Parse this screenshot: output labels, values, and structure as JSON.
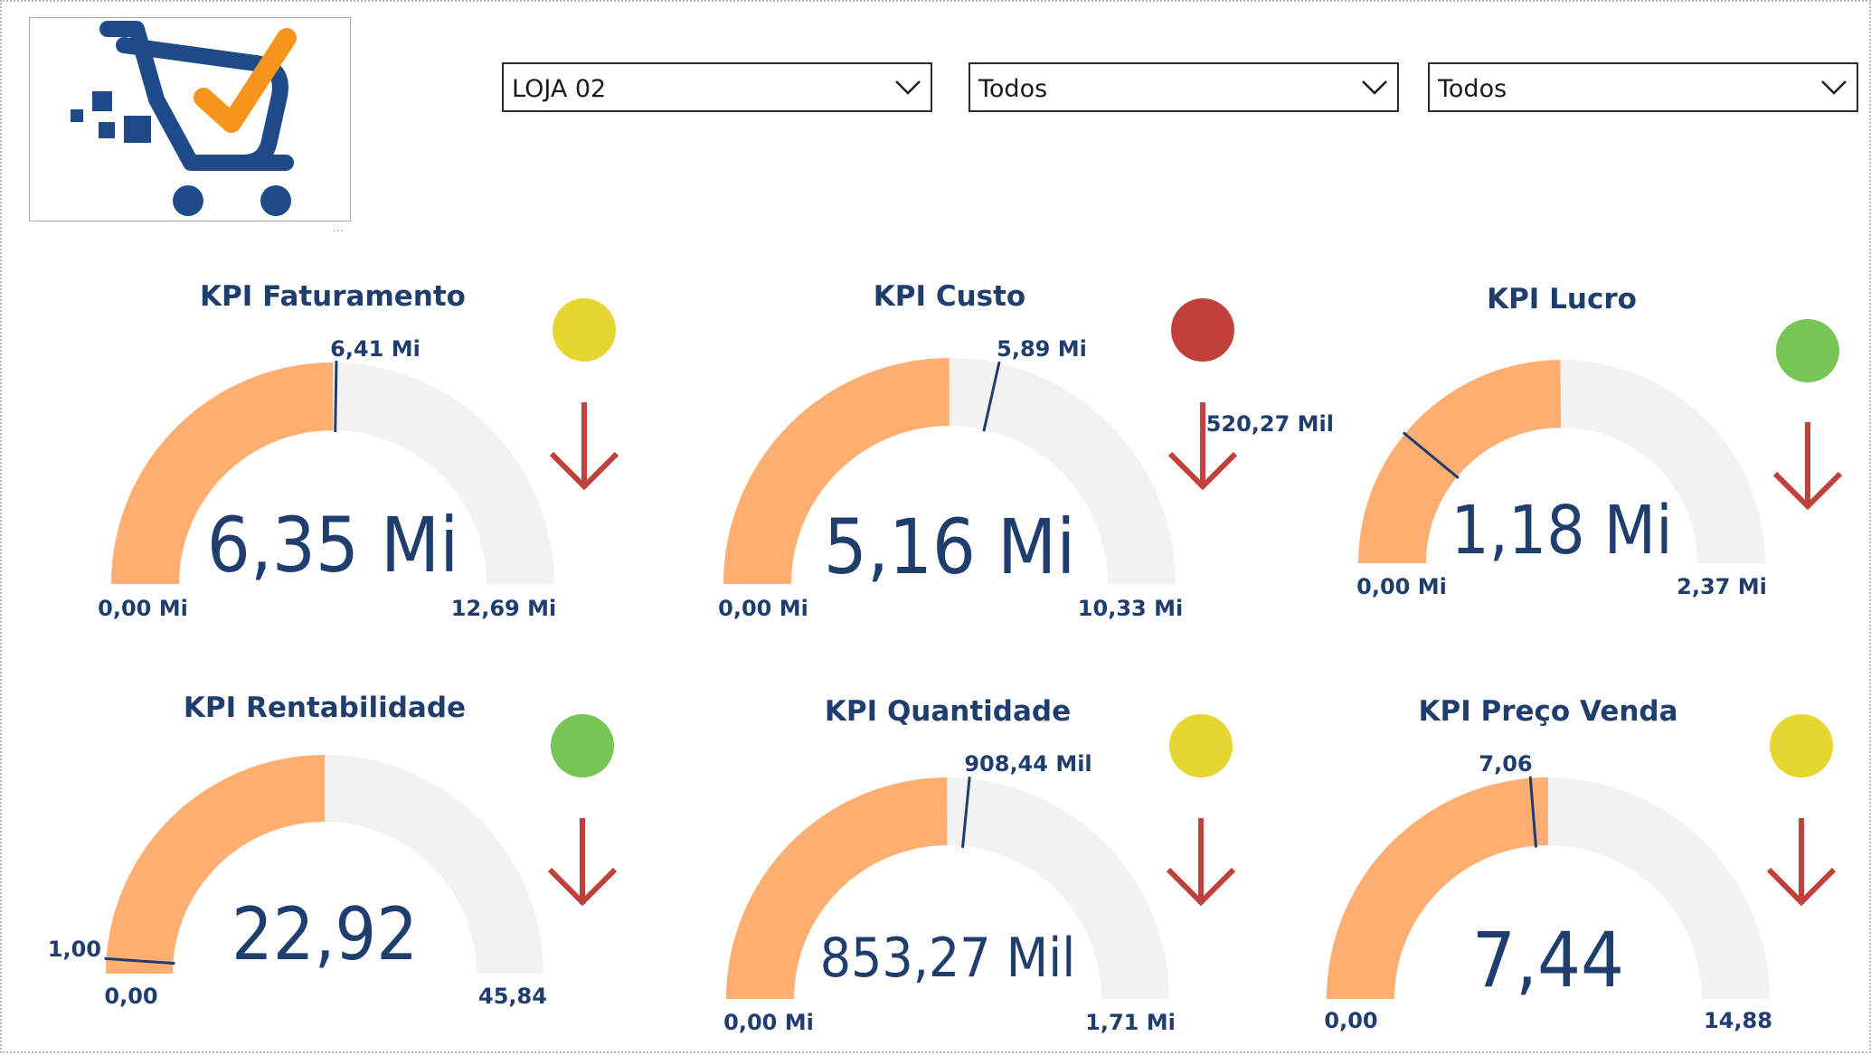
{
  "filters": [
    {
      "value": "LOJA 02",
      "icon": "chevron-down-icon"
    },
    {
      "value": "Todos",
      "icon": "chevron-down-icon"
    },
    {
      "value": "Todos",
      "icon": "chevron-down-icon"
    }
  ],
  "colors": {
    "fill": "#FDAE70",
    "track": "#F2F2F2",
    "text": "#1F3E6E",
    "needle": "#1F3E6E",
    "status_yellow": "#E6D631",
    "status_red": "#C0413B",
    "status_green": "#78C556",
    "arrow": "#C0413B"
  },
  "kpis": [
    {
      "title": "KPI Faturamento",
      "value": 6.35,
      "value_label": "6,35 Mi",
      "min": 0,
      "min_label": "0,00 Mi",
      "max": 12.69,
      "max_label": "12,69 Mi",
      "target": 6.41,
      "target_label": "6,41 Mi",
      "status": "yellow",
      "trend": "down",
      "status_icon": "status-dot-icon",
      "trend_icon": "arrow-down-icon"
    },
    {
      "title": "KPI Custo",
      "value": 5.16,
      "value_label": "5,16 Mi",
      "min": 0,
      "min_label": "0,00 Mi",
      "max": 10.33,
      "max_label": "10,33 Mi",
      "target": 5.89,
      "target_label": "5,89 Mi",
      "status": "red",
      "trend": "down",
      "status_icon": "status-dot-icon",
      "trend_icon": "arrow-down-icon"
    },
    {
      "title": "KPI Lucro",
      "value": 1.18,
      "value_label": "1,18 Mi",
      "min": 0,
      "min_label": "0,00 Mi",
      "max": 2.37,
      "max_label": "2,37 Mi",
      "target": 0.52027,
      "target_label": "520,27 Mil",
      "status": "green",
      "trend": "down",
      "status_icon": "status-dot-icon",
      "trend_icon": "arrow-down-icon"
    },
    {
      "title": "KPI Rentabilidade",
      "value": 22.92,
      "value_label": "22,92",
      "min": 0,
      "min_label": "0,00",
      "max": 45.84,
      "max_label": "45,84",
      "target": 1.0,
      "target_label": "1,00",
      "status": "green",
      "trend": "down",
      "status_icon": "status-dot-icon",
      "trend_icon": "arrow-down-icon"
    },
    {
      "title": "KPI Quantidade",
      "value": 853.27,
      "value_label": "853,27 Mil",
      "min": 0,
      "min_label": "0,00 Mi",
      "max": 1710,
      "max_label": "1,71 Mi",
      "target": 908.44,
      "target_label": "908,44 Mil",
      "status": "yellow",
      "trend": "down",
      "status_icon": "status-dot-icon",
      "trend_icon": "arrow-down-icon"
    },
    {
      "title": "KPI Preço Venda",
      "value": 7.44,
      "value_label": "7,44",
      "min": 0,
      "min_label": "0,00",
      "max": 14.88,
      "max_label": "14,88",
      "target": 7.06,
      "target_label": "7,06",
      "status": "yellow",
      "trend": "down",
      "status_icon": "status-dot-icon",
      "trend_icon": "arrow-down-icon"
    }
  ]
}
